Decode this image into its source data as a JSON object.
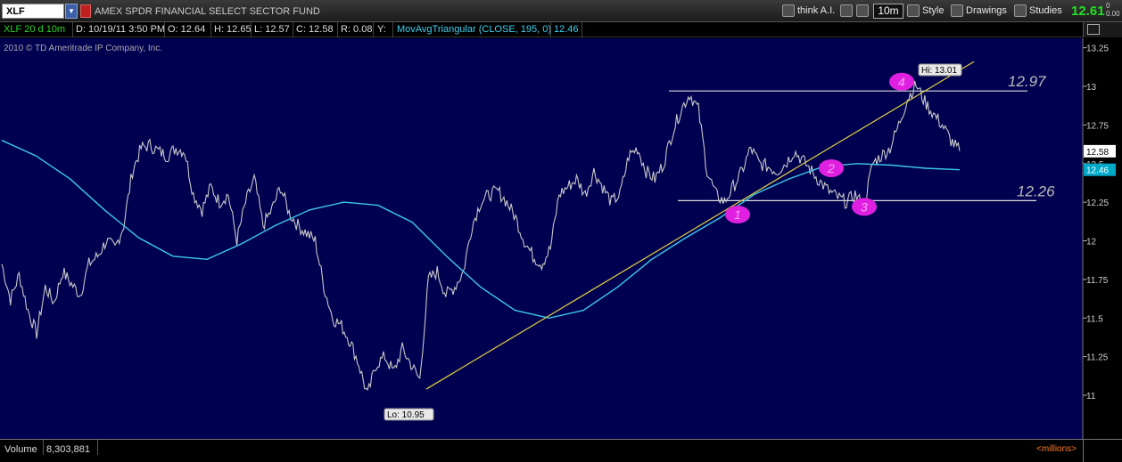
{
  "toolbar": {
    "symbol": "XLF",
    "fund_name": "AMEX SPDR FINANCIAL SELECT SECTOR FUND",
    "think_ai": "think A.I.",
    "period": "10m",
    "style": "Style",
    "drawings": "Drawings",
    "studies": "Studies",
    "last_price": "12.61",
    "chg_top": "0",
    "chg_bottom": "0.00"
  },
  "infobar": {
    "chart_label": "XLF 20 d 10m",
    "date": "D: 10/19/11 3:50 PM",
    "open": "O: 12.64",
    "high": "H: 12.65",
    "low": "L: 12.57",
    "close": "C: 12.58",
    "range": "R: 0.08",
    "y": "Y:",
    "study": "MovAvgTriangular (CLOSE, 195, 0)",
    "study_value": "12.46"
  },
  "copyright": "2010 © TD Ameritrade IP Company, Inc.",
  "volume": {
    "label": "Volume",
    "value": "8,303,881",
    "units": "<millions>"
  },
  "chart_data": {
    "type": "line",
    "ylim": [
      10.8,
      13.3
    ],
    "y_ticks": [
      "13.25",
      "13",
      "12.75",
      "12.5",
      "12.25",
      "12",
      "11.75",
      "11.5",
      "11.25",
      "11"
    ],
    "last_price_label": "12.58",
    "ma_value_label": "12.46",
    "hi_label": "Hi: 13.01",
    "lo_label": "Lo: 10.95",
    "levels": [
      {
        "value": 12.97,
        "label": "12.97"
      },
      {
        "value": 12.26,
        "label": "12.26"
      }
    ],
    "points_labels": [
      "1",
      "2",
      "3",
      "4"
    ],
    "colors": {
      "background": "#000050",
      "price": "#c8c8c8",
      "ma": "#3cc8e8",
      "trend": "#e0d040",
      "marker": "#e020e0",
      "last_price_tag": "#ffffff",
      "ma_tag": "#00a8c8"
    },
    "series": [
      {
        "values": [
          11.85,
          11.62,
          11.78,
          11.55,
          11.4,
          11.7,
          11.6,
          11.8,
          11.72,
          11.65,
          11.85,
          11.9,
          12.0,
          11.95,
          12.1,
          12.45,
          12.6,
          12.62,
          12.58,
          12.55,
          12.6,
          12.58,
          12.3,
          12.2,
          12.35,
          12.25,
          12.3,
          12.0,
          12.25,
          12.4,
          12.1,
          12.2,
          12.35,
          12.18,
          12.1,
          12.05,
          12.0,
          11.7,
          11.5,
          11.45,
          11.35,
          11.2,
          11.0,
          11.2,
          11.25,
          11.15,
          11.3,
          11.2,
          11.1,
          11.75,
          11.8,
          11.65,
          11.7,
          11.8,
          12.1,
          12.25,
          12.3,
          12.32,
          12.25,
          12.15,
          12.0,
          11.9,
          11.85,
          11.95,
          12.3,
          12.35,
          12.4,
          12.3,
          12.45,
          12.35,
          12.25,
          12.3,
          12.55,
          12.6,
          12.45,
          12.4,
          12.5,
          12.7,
          12.85,
          12.95,
          12.85,
          12.45,
          12.3,
          12.25,
          12.35,
          12.45,
          12.6,
          12.5,
          12.48,
          12.45,
          12.5,
          12.58,
          12.52,
          12.45,
          12.38,
          12.32,
          12.28,
          12.25,
          12.3,
          12.22,
          12.5,
          12.55,
          12.6,
          12.75,
          12.92,
          13.01,
          12.9,
          12.82,
          12.75,
          12.65,
          12.58
        ]
      },
      {
        "values": [
          12.65,
          12.55,
          12.4,
          12.2,
          12.02,
          11.9,
          11.88,
          11.98,
          12.1,
          12.2,
          12.25,
          12.23,
          12.12,
          11.9,
          11.7,
          11.55,
          11.5,
          11.55,
          11.7,
          11.88,
          12.02,
          12.15,
          12.3,
          12.4,
          12.48,
          12.5,
          12.49,
          12.47,
          12.46
        ]
      }
    ]
  }
}
